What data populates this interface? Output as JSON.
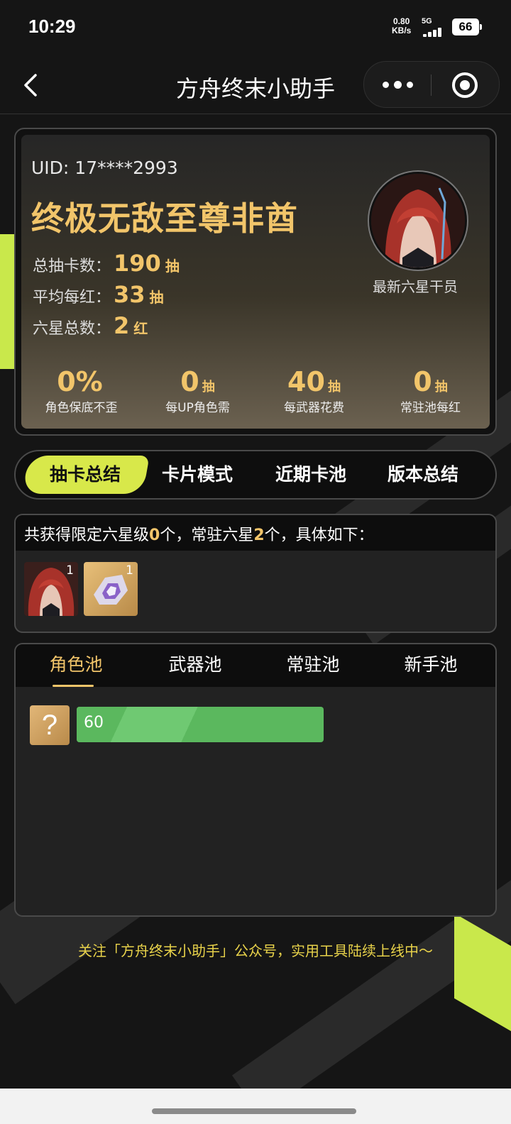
{
  "status_bar": {
    "time": "10:29",
    "net_speed_value": "0.80",
    "net_speed_unit": "KB/s",
    "network": "5G",
    "battery": "66"
  },
  "nav": {
    "title": "方舟终末小助手"
  },
  "summary": {
    "uid": "UID: 17****2993",
    "title": "终极无敌至尊非酋",
    "stats": [
      {
        "label": "总抽卡数：",
        "value": "190",
        "unit": "抽"
      },
      {
        "label": "平均每红：",
        "value": "33",
        "unit": "抽"
      },
      {
        "label": "六星总数：",
        "value": "2",
        "unit": "红"
      }
    ],
    "avatar_caption": "最新六星干员",
    "mini_stats": [
      {
        "value": "0%",
        "unit": "",
        "label": "角色保底不歪"
      },
      {
        "value": "0",
        "unit": "抽",
        "label": "每UP角色需"
      },
      {
        "value": "40",
        "unit": "抽",
        "label": "每武器花费"
      },
      {
        "value": "0",
        "unit": "抽",
        "label": "常驻池每红"
      }
    ]
  },
  "main_tabs": [
    {
      "label": "抽卡总结",
      "active": true
    },
    {
      "label": "卡片模式",
      "active": false
    },
    {
      "label": "近期卡池",
      "active": false
    },
    {
      "label": "版本总结",
      "active": false
    }
  ],
  "six_star": {
    "text_1": "共获得限定六星级",
    "limited_count": "0",
    "text_2": "个，常驻六星",
    "standard_count": "2",
    "text_3": "个，具体如下：",
    "items": [
      {
        "icon": "operator-portrait-icon",
        "count": "1"
      },
      {
        "icon": "weapon-crystal-icon",
        "count": "1"
      }
    ]
  },
  "pool_tabs": [
    {
      "label": "角色池",
      "active": true
    },
    {
      "label": "武器池",
      "active": false
    },
    {
      "label": "常驻池",
      "active": false
    },
    {
      "label": "新手池",
      "active": false
    }
  ],
  "pool_entry": {
    "icon": "question-mark-icon",
    "icon_text": "?",
    "value": "60",
    "progress_fraction": 0.75
  },
  "footer": {
    "text": "关注「方舟终末小助手」公众号，实用工具陆续上线中～"
  },
  "colors": {
    "accent_gold": "#f2c56a",
    "accent_lime": "#d8e84a",
    "progress_green": "#5bb85e"
  }
}
